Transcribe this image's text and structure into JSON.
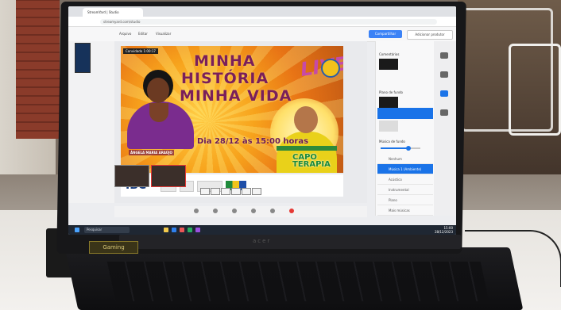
{
  "browser": {
    "tab_title": "StreamYard | Studio",
    "url": "streamyard.com/studio"
  },
  "app": {
    "menu": [
      "Arquivo",
      "Editar",
      "Visualizar"
    ],
    "present_button": "Compartilhar",
    "producer_button": "Adicionar produtor"
  },
  "stage": {
    "tag": "Convidado 1:00:17",
    "title_line1": "MINHA",
    "title_line2": "HISTÓRIA",
    "title_line3": "MINHA VIDA",
    "live_text": "LIVE",
    "guest_name": "ÂNGELA MARIA ARAÚJO",
    "date_text": "Dia 28/12 às 15:00 horas",
    "capo_line1": "CAPO",
    "capo_line2": "TERAPIA"
  },
  "sponsors": {
    "ibc_label": "IBC"
  },
  "right_panel": {
    "section1": "Comentários",
    "section2": "Plano de fundo",
    "section3": "Música de fundo",
    "items": [
      "Nenhum",
      "Música 1 (Ambiente)",
      "Acústico",
      "Instrumental",
      "Piano",
      "Mais músicas"
    ],
    "volume_level": 0.7
  },
  "taskbar": {
    "search_placeholder": "Pesquisar",
    "time": "15:00",
    "date": "28/12/2023"
  },
  "laptop": {
    "sticker_text": "Gaming"
  }
}
